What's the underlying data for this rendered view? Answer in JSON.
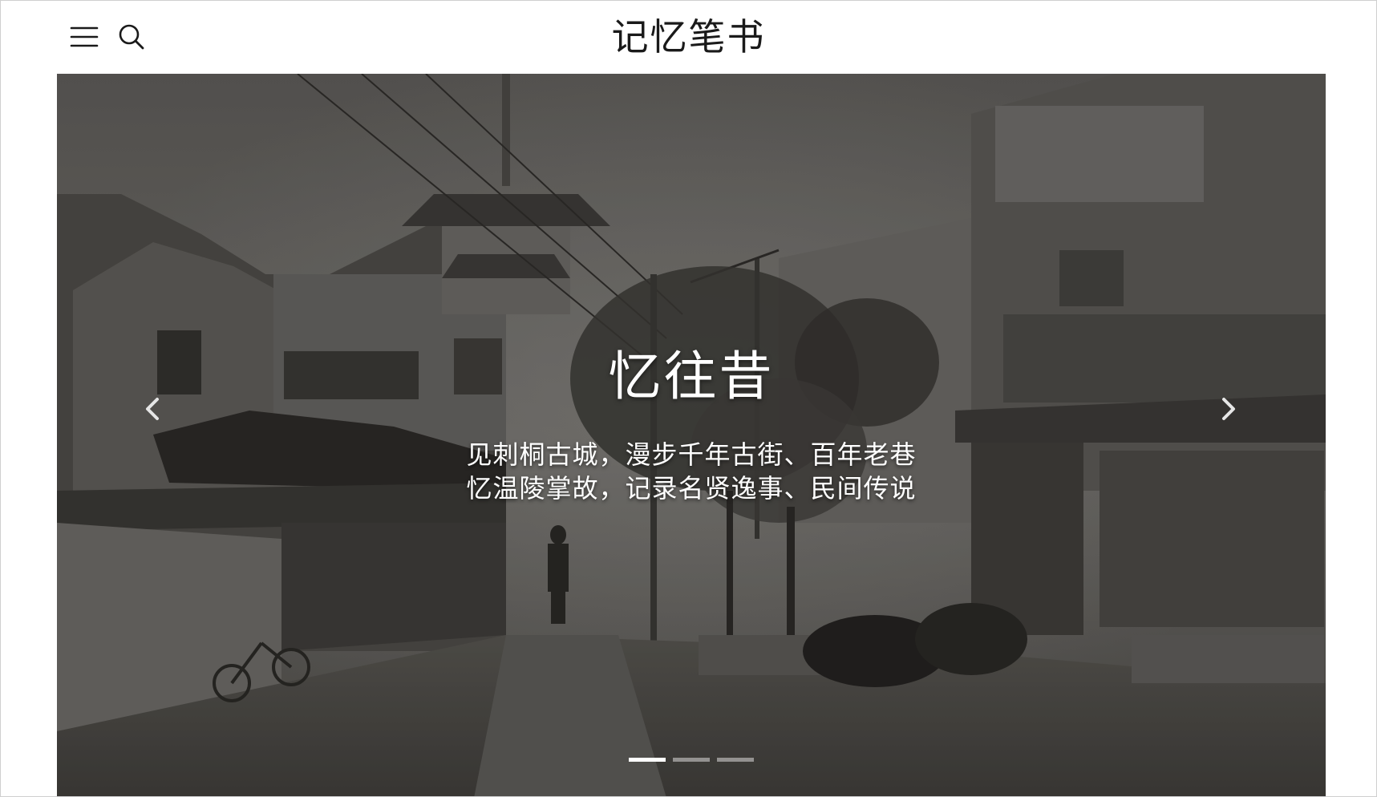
{
  "header": {
    "site_title": "记忆笔书",
    "menu_icon": "hamburger-menu-icon",
    "search_icon": "search-icon"
  },
  "hero": {
    "title": "忆往昔",
    "line1": "见刺桐古城，漫步千年古街、百年老巷",
    "line2": "忆温陵掌故，记录名贤逸事、民间传说",
    "prev_icon": "chevron-left-icon",
    "next_icon": "chevron-right-icon",
    "slides_count": 3,
    "active_slide": 1
  },
  "colors": {
    "header_bg": "#ffffff",
    "title_text": "#1a1a1a",
    "hero_text": "#ffffff",
    "indicator_inactive": "#a8a7a5"
  }
}
